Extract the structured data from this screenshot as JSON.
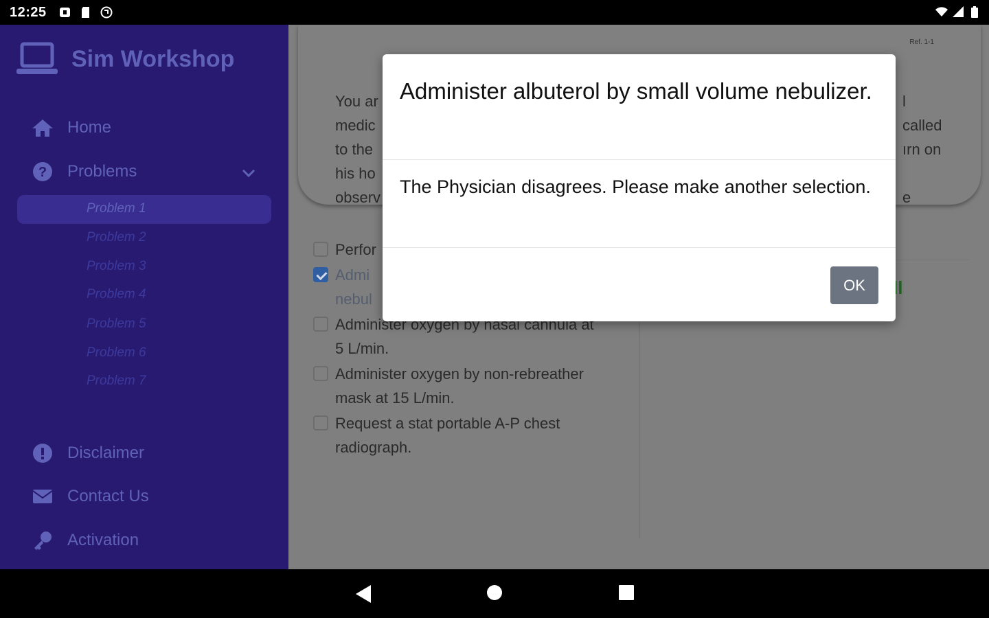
{
  "status_bar": {
    "time": "12:25"
  },
  "sidebar": {
    "app_title": "Sim Workshop",
    "nav": [
      {
        "label": "Home",
        "icon": "home-icon"
      },
      {
        "label": "Problems",
        "icon": "help-circle-icon"
      },
      {
        "label": "Disclaimer",
        "icon": "alert-circle-icon"
      },
      {
        "label": "Contact Us",
        "icon": "envelope-icon"
      },
      {
        "label": "Activation",
        "icon": "key-icon"
      }
    ],
    "problems": [
      "Problem 1",
      "Problem 2",
      "Problem 3",
      "Problem 4",
      "Problem 5",
      "Problem 6",
      "Problem 7"
    ],
    "active_problem_index": 0
  },
  "main": {
    "ref": "Ref. 1-1",
    "card_left_lines": "You ar\nmedic\nto the\nhis ho\nobserv",
    "card_right_lines": "l\ncalled\nırn on\n\ne",
    "options": [
      {
        "text": "Perfor",
        "checked": false
      },
      {
        "text": "Admi\nnebul",
        "checked": true
      },
      {
        "text": "Administer oxygen by nasal cannula at\n5 L/min.",
        "checked": false
      },
      {
        "text": "Administer oxygen by non-rebreather\nmask at 15 L/min.",
        "checked": false
      },
      {
        "text": "Request a stat portable A-P chest\nradiograph.",
        "checked": false
      }
    ],
    "right_fragment": "ll"
  },
  "modal": {
    "title": "Administer albuterol by small volume nebulizer.",
    "body": "The Physician disagrees. Please make another selection.",
    "ok_label": "OK"
  },
  "colors": {
    "sidebar_bg": "#281a70",
    "sidebar_text": "#5f62b8",
    "ok_button": "#6b7480",
    "overlay": "#7f7f7f"
  }
}
